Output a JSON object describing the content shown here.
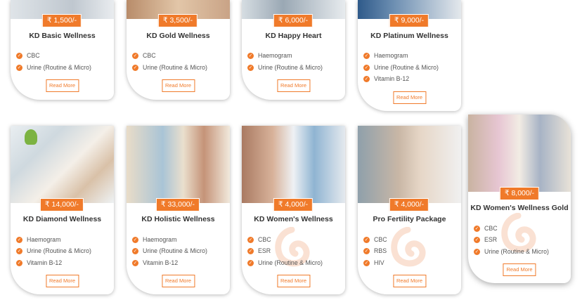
{
  "colors": {
    "accent": "#f07a2a"
  },
  "cards": [
    {
      "price": "₹ 1,500/-",
      "title": "KD Basic Wellness",
      "features": [
        "CBC",
        "Urine (Routine & Micro)"
      ],
      "cta": "Read More"
    },
    {
      "price": "₹ 3,500/-",
      "title": "KD Gold Wellness",
      "features": [
        "CBC",
        "Urine (Routine & Micro)"
      ],
      "cta": "Read More"
    },
    {
      "price": "₹ 6,000/-",
      "title": "KD Happy Heart",
      "features": [
        "Haemogram",
        "Urine (Routine & Micro)"
      ],
      "cta": "Read More"
    },
    {
      "price": "₹ 9,000/-",
      "title": "KD Platinum Wellness",
      "features": [
        "Haemogram",
        "Urine (Routine & Micro)",
        "Vitamin B-12"
      ],
      "cta": "Read More"
    },
    {
      "price": "₹ 14,000/-",
      "title": "KD Diamond Wellness",
      "features": [
        "Haemogram",
        "Urine (Routine & Micro)",
        "Vitamin B-12"
      ],
      "cta": "Read More"
    },
    {
      "price": "₹ 33,000/-",
      "title": "KD Holistic Wellness",
      "features": [
        "Haemogram",
        "Urine (Routine & Micro)",
        "Vitamin B-12"
      ],
      "cta": "Read More"
    },
    {
      "price": "₹ 4,000/-",
      "title": "KD Women's Wellness",
      "features": [
        "CBC",
        "ESR",
        "Urine (Routine & Micro)"
      ],
      "cta": "Read More"
    },
    {
      "price": "₹ 4,000/-",
      "title": "Pro Fertility Package",
      "features": [
        "CBC",
        "RBS",
        "HIV"
      ],
      "cta": "Read More"
    },
    {
      "price": "₹ 8,000/-",
      "title": "KD Women's Wellness Gold",
      "features": [
        "CBC",
        "ESR",
        "Urine (Routine & Micro)"
      ],
      "cta": "Read More"
    }
  ]
}
